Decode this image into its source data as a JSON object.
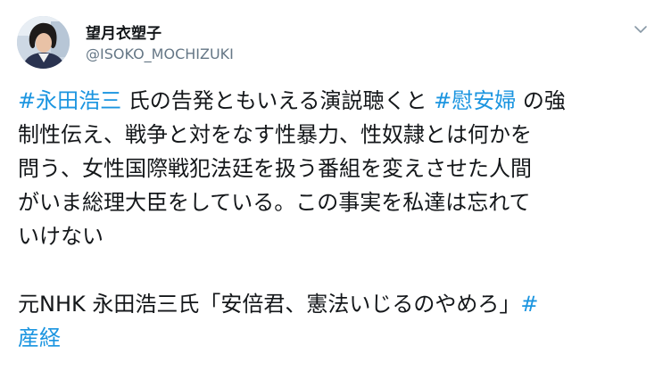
{
  "tweet": {
    "author": {
      "display_name": "望月衣塑子",
      "handle": "@ISOKO_MOCHIZUKI"
    },
    "menu_icon": "chevron-down-icon",
    "avatar_icon": "profile-photo",
    "colors": {
      "hashtag": "#1b95e0",
      "text": "#14171a",
      "handle": "#657786"
    },
    "body": {
      "l1_tag1": "#永田浩三",
      "l1_text1": " 氏の告発ともいえる演説聴くと ",
      "l1_tag2": "#慰安婦",
      "l1_text2": " の強",
      "l2": "制性伝え、戦争と対をなす性暴力、性奴隷とは何かを",
      "l3": "問う、女性国際戦犯法廷を扱う番組を変えさせた人間",
      "l4": "がいま総理大臣をしている。この事実を私達は忘れて",
      "l5": "いけない",
      "l6_text": "元NHK 永田浩三氏「安倍君、憲法いじるのやめろ」",
      "l6_tag_start": "#",
      "l7_tag_end": "産経"
    }
  }
}
